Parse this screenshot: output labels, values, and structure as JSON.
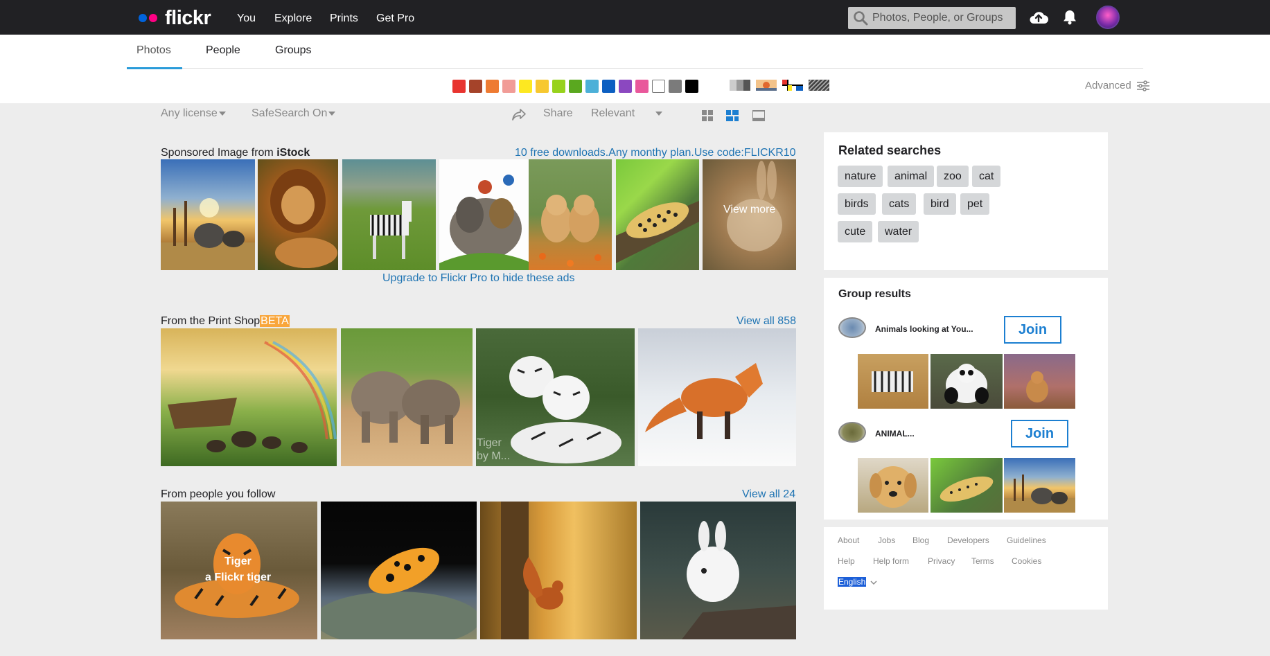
{
  "brand": {
    "name": "flickr"
  },
  "nav": {
    "you": "You",
    "explore": "Explore",
    "prints": "Prints",
    "get_pro": "Get Pro"
  },
  "search": {
    "placeholder": "Photos, People, or Groups"
  },
  "tabs": {
    "photos": "Photos",
    "people": "People",
    "groups": "Groups"
  },
  "colors": [
    "#e8342f",
    "#a5432a",
    "#ee7b32",
    "#f19c97",
    "#fde821",
    "#f7c830",
    "#97d21c",
    "#5aa81f",
    "#4cb0d8",
    "#0c5fc1",
    "#8b48c0",
    "#e9589b",
    "#ffffff",
    "#7b7b7b",
    "#000000"
  ],
  "advanced_label": "Advanced",
  "filters": {
    "license": "Any license",
    "safesearch": "SafeSearch On",
    "share": "Share",
    "sort": "Relevant"
  },
  "sponsored": {
    "title_prefix": "Sponsored Image from ",
    "title_brand": "iStock",
    "promo": "10 free downloads.Any monthy plan.Use code:FLICKR10",
    "view_more": "View more",
    "upgrade": "Upgrade to Flickr Pro to hide these ads"
  },
  "print_shop": {
    "title": "From the Print Shop",
    "badge": "BETA",
    "view_all": "View all 858",
    "overlay_line1": "Tiger",
    "overlay_line2": "by M..."
  },
  "following": {
    "title": "From people you follow",
    "view_all": "View all 24",
    "overlay_title": "Tiger",
    "overlay_sub": "a Flickr tiger"
  },
  "related": {
    "title": "Related searches",
    "chips": [
      "nature",
      "animal",
      "zoo",
      "cat",
      "birds",
      "cats",
      "bird",
      "pet",
      "cute",
      "water"
    ]
  },
  "groups": {
    "title": "Group results",
    "items": [
      {
        "name": "Animals looking at You...",
        "join": "Join"
      },
      {
        "name": "ANIMAL...",
        "join": "Join"
      }
    ]
  },
  "footer": {
    "links": [
      "About",
      "Jobs",
      "Blog",
      "Developers",
      "Guidelines",
      "Help",
      "Help form",
      "Privacy",
      "Terms",
      "Cookies"
    ],
    "language": "English"
  }
}
